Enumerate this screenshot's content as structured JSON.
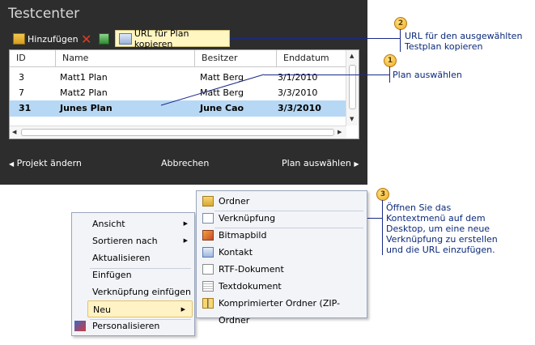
{
  "window": {
    "title": "Testcenter"
  },
  "toolbar": {
    "add_label": "Hinzufügen",
    "delete_glyph": "✕",
    "copy_url_label": "URL für Plan kopieren"
  },
  "grid": {
    "columns": [
      "ID",
      "Name",
      "Besitzer",
      "Enddatum"
    ],
    "rows": [
      {
        "id": "3",
        "name": "Matt1 Plan",
        "owner": "Matt Berg",
        "end": "3/1/2010",
        "selected": false
      },
      {
        "id": "7",
        "name": "Matt2 Plan",
        "owner": "Matt Berg",
        "end": "3/3/2010",
        "selected": false
      },
      {
        "id": "31",
        "name": "Junes Plan",
        "owner": "June Cao",
        "end": "3/3/2010",
        "selected": true
      }
    ]
  },
  "nav": {
    "change_project": "Projekt ändern",
    "cancel": "Abbrechen",
    "select_plan": "Plan auswählen"
  },
  "callouts": [
    {
      "number": "1",
      "text": "Plan auswählen"
    },
    {
      "number": "2",
      "text_lines": [
        "URL für den ausgewählten",
        "Testplan kopieren"
      ]
    },
    {
      "number": "3",
      "text_lines": [
        "Öffnen Sie das",
        "Kontextmenü auf dem",
        "Desktop, um eine neue",
        "Verknüpfung zu erstellen",
        "und die URL einzufügen."
      ]
    }
  ],
  "context_menu": {
    "items": [
      "Ansicht",
      "Sortieren nach",
      "Aktualisieren",
      "Einfügen",
      "Verknüpfung einfügen",
      "Neu",
      "Personalisieren"
    ]
  },
  "new_submenu": {
    "items": [
      "Ordner",
      "Verknüpfung",
      "Bitmapbild",
      "Kontakt",
      "RTF-Dokument",
      "Textdokument",
      "Komprimierter Ordner (ZIP-Ordner"
    ]
  },
  "colors": {
    "panel_bg": "#2d2d2d",
    "selected_row": "#b7d8f4",
    "callout_line": "#1a2a8a",
    "badge": "#f0a818",
    "menu_highlight": "#fff2c4"
  }
}
